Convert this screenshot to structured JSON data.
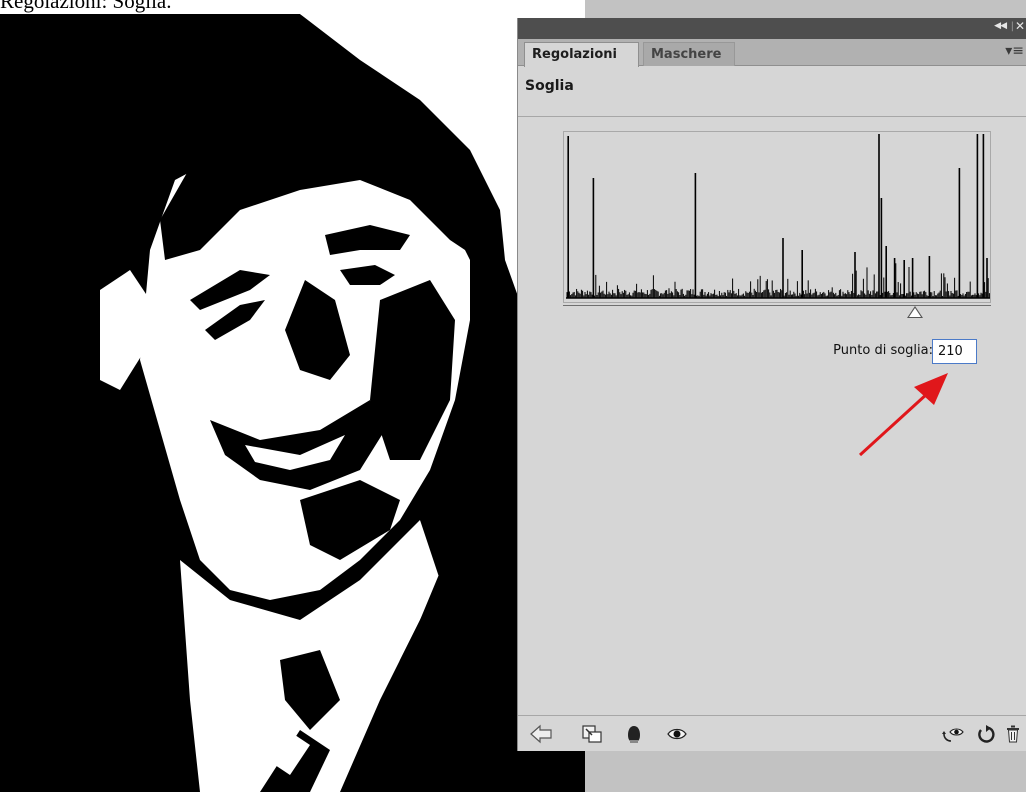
{
  "caption": "Regolazioni: Soglia.",
  "panel": {
    "tabs": [
      {
        "label": "Regolazioni",
        "active": true
      },
      {
        "label": "Maschere",
        "active": false
      }
    ],
    "title": "Soglia",
    "threshold": {
      "label": "Punto di soglia:",
      "value": "210",
      "max": 255
    },
    "icons": {
      "collapse": "collapse-double-arrow-icon",
      "close": "close-icon",
      "menu": "panel-menu-icon",
      "back": "back-arrow-icon",
      "clip": "clip-to-layer-icon",
      "mask": "layer-mask-icon",
      "visibility": "eye-visibility-icon",
      "view_previous": "view-previous-state-icon",
      "reset": "reset-icon",
      "delete": "trash-icon"
    }
  },
  "colors": {
    "panel_bg": "#d6d6d6",
    "titlebar": "#4e4e4e",
    "arrow": "#e0171b"
  }
}
